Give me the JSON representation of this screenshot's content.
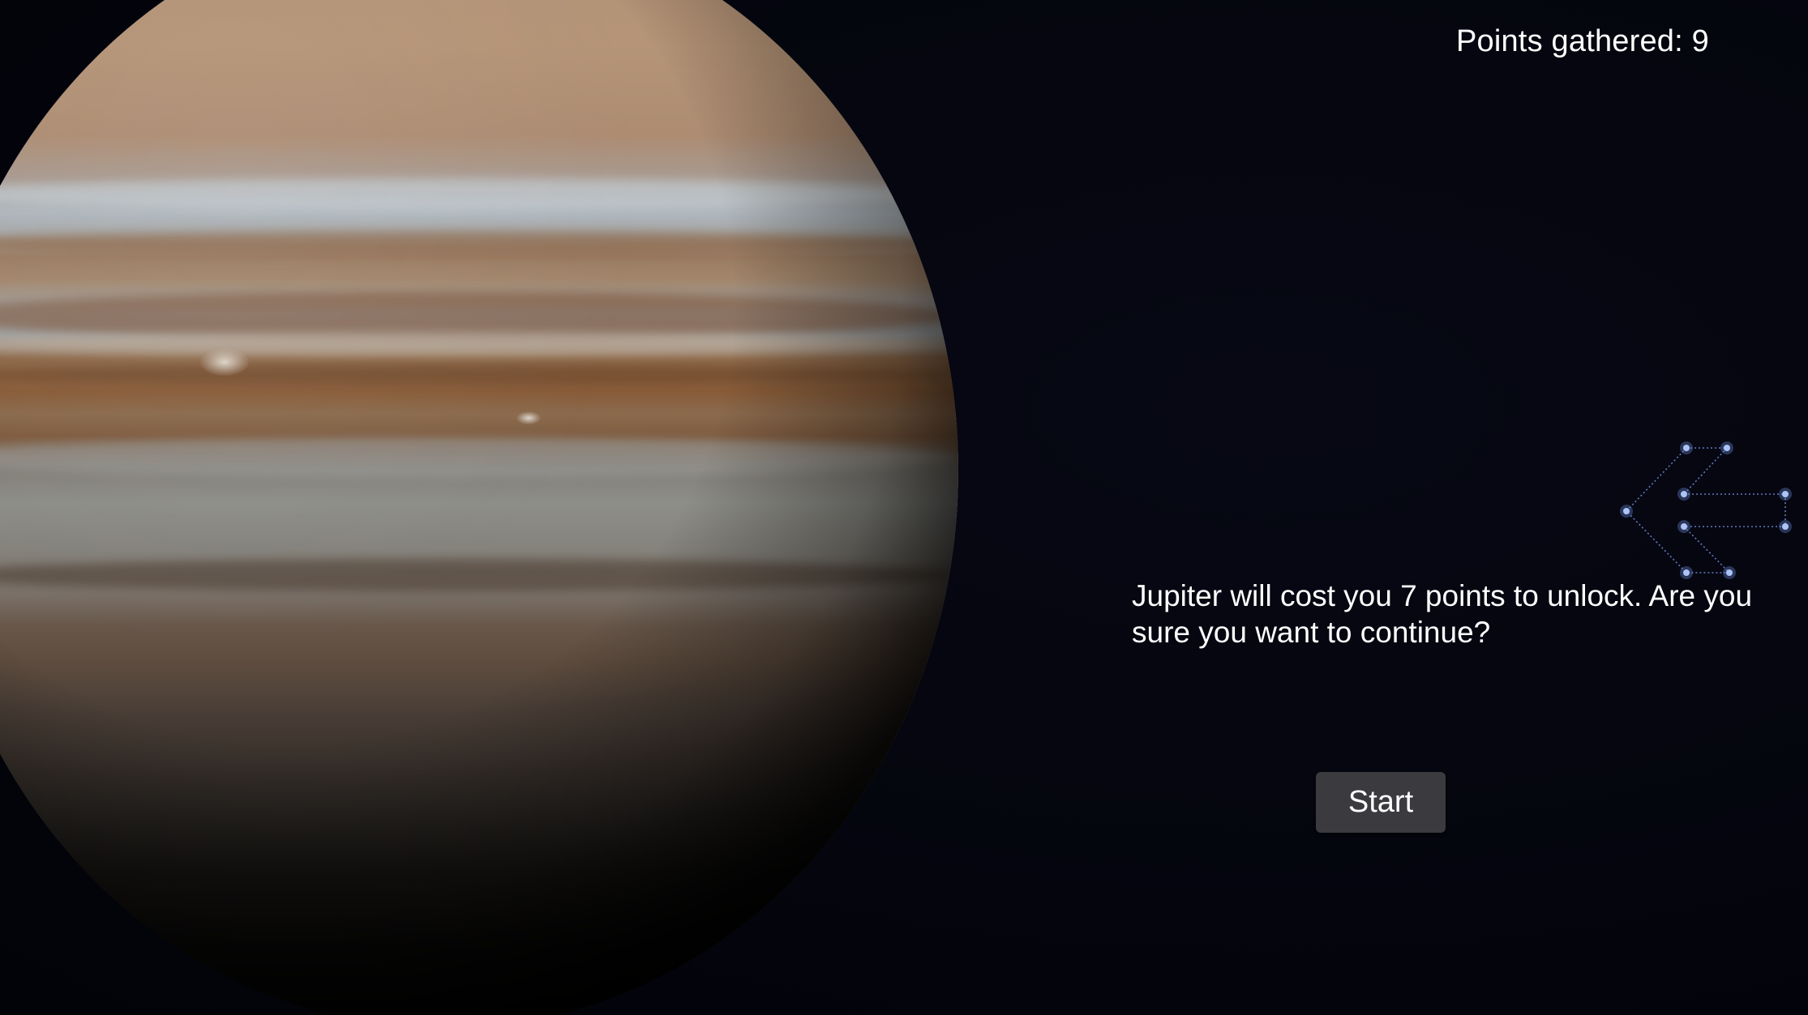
{
  "hud": {
    "points_label": "Points gathered: 9"
  },
  "unlock_dialog": {
    "message": "Jupiter will cost you 7 points to unlock. Are you sure you want to continue?",
    "start_label": "Start"
  },
  "icons": {
    "back": "constellation-arrow-left-icon",
    "planet": "jupiter"
  },
  "colors": {
    "background": "#04050d",
    "text": "#ffffff",
    "button": "#3a3a3f",
    "constellation": "#6f8fe0"
  }
}
